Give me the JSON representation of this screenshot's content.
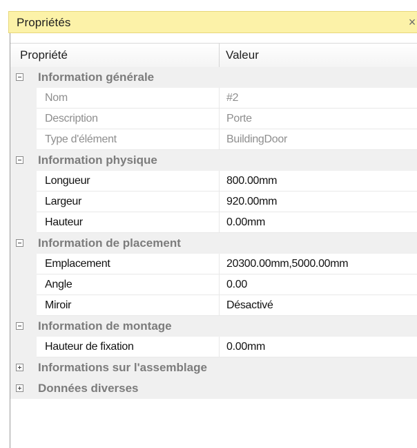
{
  "panel": {
    "title": "Propriétés",
    "close_glyph": "×"
  },
  "header": {
    "property": "Propriété",
    "value": "Valeur"
  },
  "categories": [
    {
      "label": "Information générale",
      "expanded": true,
      "rows": [
        {
          "property": "Nom",
          "value": "#2",
          "readonly": true
        },
        {
          "property": "Description",
          "value": "Porte",
          "readonly": true
        },
        {
          "property": "Type d'élément",
          "value": "BuildingDoor",
          "readonly": true
        }
      ]
    },
    {
      "label": "Information physique",
      "expanded": true,
      "rows": [
        {
          "property": "Longueur",
          "value": "800.00mm",
          "readonly": false
        },
        {
          "property": "Largeur",
          "value": "920.00mm",
          "readonly": false
        },
        {
          "property": "Hauteur",
          "value": "0.00mm",
          "readonly": false
        }
      ]
    },
    {
      "label": "Information de placement",
      "expanded": true,
      "rows": [
        {
          "property": "Emplacement",
          "value": "20300.00mm,5000.00mm",
          "readonly": false
        },
        {
          "property": "Angle",
          "value": "0.00",
          "readonly": false
        },
        {
          "property": "Miroir",
          "value": "Désactivé",
          "readonly": false
        }
      ]
    },
    {
      "label": "Information de montage",
      "expanded": true,
      "rows": [
        {
          "property": "Hauteur de fixation",
          "value": "0.00mm",
          "readonly": false
        }
      ]
    },
    {
      "label": "Informations sur l'assemblage",
      "expanded": false,
      "rows": []
    },
    {
      "label": "Données diverses",
      "expanded": false,
      "rows": []
    }
  ]
}
